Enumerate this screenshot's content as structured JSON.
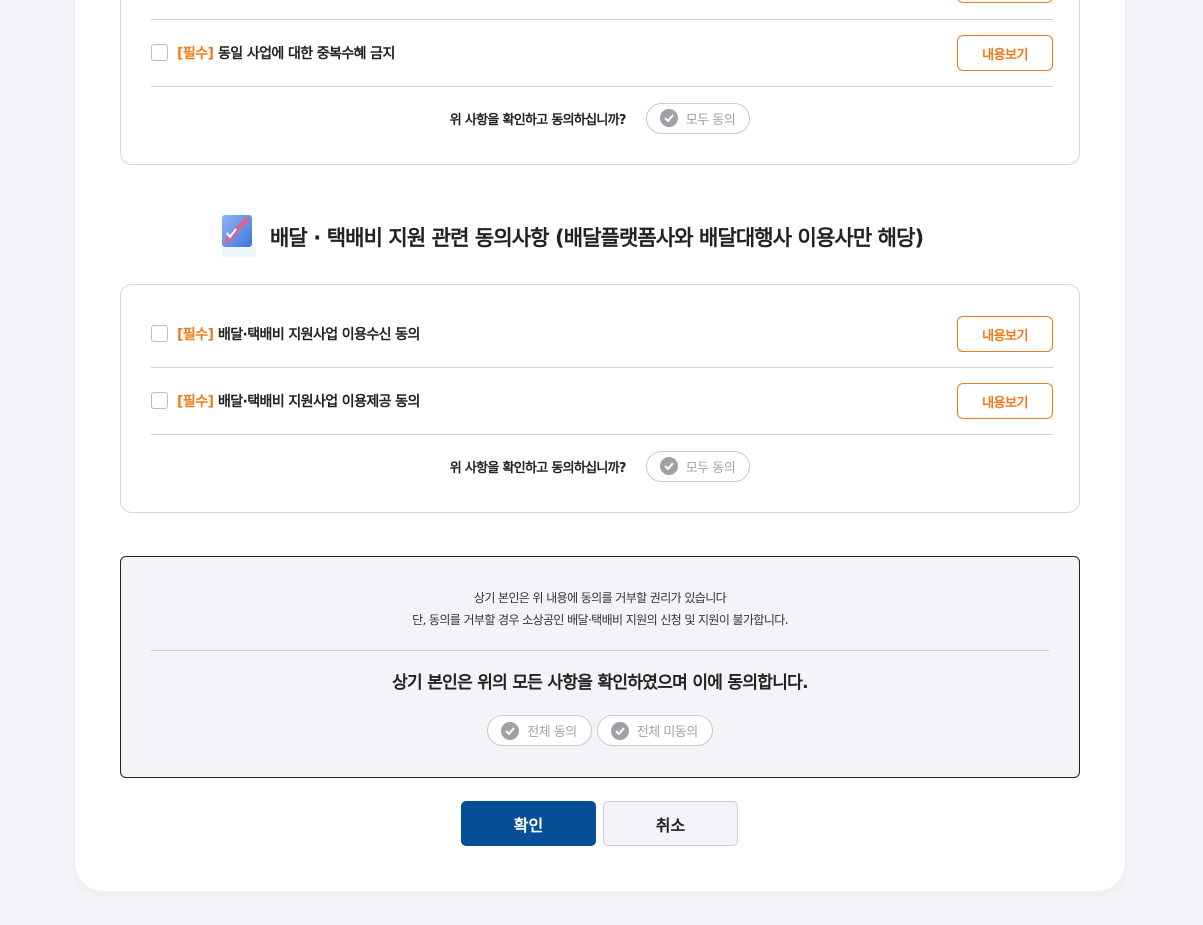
{
  "section1": {
    "items": [
      {
        "tag": "[필수]",
        "label": "동일 사업에 대한 중복수혜 금지",
        "button": "내용보기"
      }
    ],
    "confirm_question": "위 사항을 확인하고 동의하십니까?",
    "agree_all": "모두 동의"
  },
  "section2": {
    "title": "배달 · 택배비 지원 관련 동의사항 (배달플랫폼사와 배달대행사 이용사만 해당)",
    "items": [
      {
        "tag": "[필수]",
        "label": "배달·택배비 지원사업 이용수신 동의",
        "button": "내용보기"
      },
      {
        "tag": "[필수]",
        "label": "배달·택배비 지원사업 이용제공 동의",
        "button": "내용보기"
      }
    ],
    "confirm_question": "위 사항을 확인하고 동의하십니까?",
    "agree_all": "모두 동의"
  },
  "notice": {
    "line1": "상기 본인은 위 내용에 동의를 거부할 권리가 있습니다",
    "line2": "단, 동의를 거부할 경우 소상공인 배달·택배비 지원의 신청 및 지원이 불가합니다.",
    "statement": "상기 본인은 위의 모든 사항을 확인하였으며 이에 동의합니다.",
    "agree_all": "전체 동의",
    "disagree_all": "전체 미동의"
  },
  "buttons": {
    "confirm": "확인",
    "cancel": "취소"
  },
  "colors": {
    "accent_orange": "#f07a1b",
    "primary_blue": "#064f96",
    "check_gray": "#a0a0a6"
  },
  "icons": {
    "section_icon": "pencil-note-icon",
    "check": "check-circle-icon"
  }
}
